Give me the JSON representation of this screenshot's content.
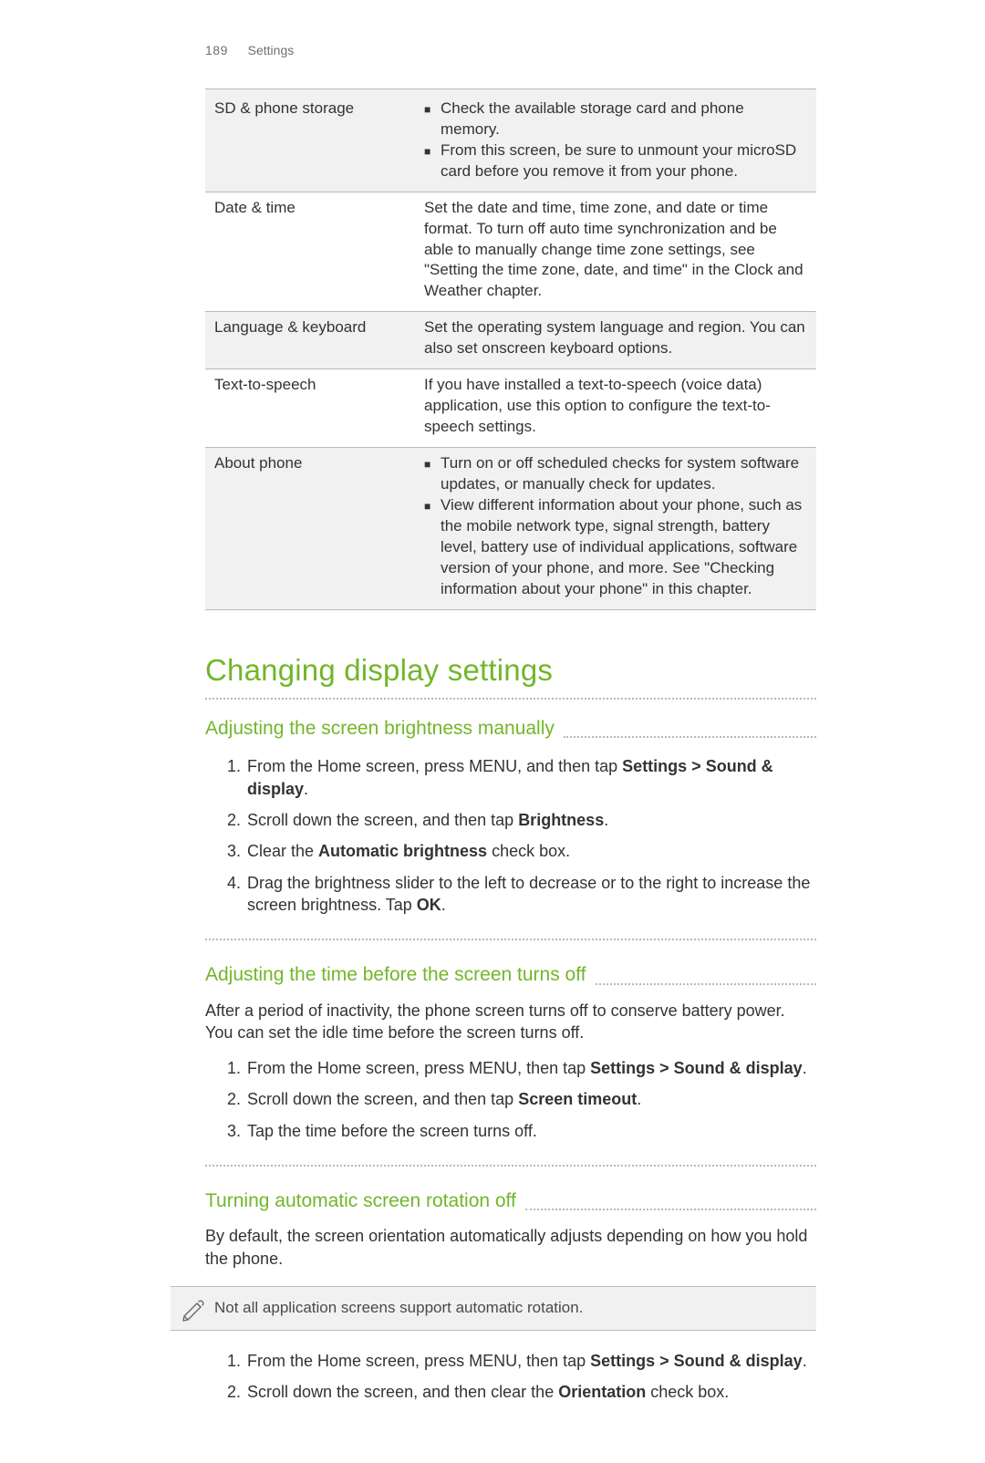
{
  "header": {
    "page_number": "189",
    "chapter": "Settings"
  },
  "settings_table": {
    "rows": [
      {
        "label": "SD & phone storage",
        "bullets": [
          "Check the available storage card and phone memory.",
          "From this screen, be sure to unmount your microSD card before you remove it from your phone."
        ]
      },
      {
        "label": "Date & time",
        "text": "Set the date and time, time zone, and date or time format. To turn off auto time synchronization and be able to manually change time zone settings, see \"Setting the time zone, date, and time\" in the Clock and Weather chapter."
      },
      {
        "label": "Language & keyboard",
        "text": "Set the operating system language and region. You can also set onscreen keyboard options."
      },
      {
        "label": "Text-to-speech",
        "text": "If you have installed a text-to-speech (voice data) application, use this option to configure the text-to-speech settings."
      },
      {
        "label": "About phone",
        "bullets": [
          "Turn on or off scheduled checks for system software updates, or manually check for updates.",
          "View different information about your phone, such as the mobile network type, signal strength, battery level, battery use of individual applications, software version of your phone, and more. See \"Checking information about your phone\" in this chapter."
        ]
      }
    ]
  },
  "section": {
    "title": "Changing display settings",
    "sub1": {
      "heading": "Adjusting the screen brightness manually",
      "steps": {
        "s1a": "From the Home screen, press MENU, and then tap ",
        "s1b": "Settings > Sound & display",
        "s1c": ".",
        "s2a": "Scroll down the screen, and then tap ",
        "s2b": "Brightness",
        "s2c": ".",
        "s3a": "Clear the ",
        "s3b": "Automatic brightness",
        "s3c": " check box.",
        "s4a": "Drag the brightness slider to the left to decrease or to the right to increase the screen brightness. Tap ",
        "s4b": "OK",
        "s4c": "."
      }
    },
    "sub2": {
      "heading": "Adjusting the time before the screen turns off",
      "intro": "After a period of inactivity, the phone screen turns off to conserve battery power. You can set the idle time before the screen turns off.",
      "steps": {
        "s1a": "From the Home screen, press MENU, then tap ",
        "s1b": "Settings > Sound & display",
        "s1c": ".",
        "s2a": "Scroll down the screen, and then tap ",
        "s2b": "Screen timeout",
        "s2c": ".",
        "s3": "Tap the time before the screen turns off."
      }
    },
    "sub3": {
      "heading": "Turning automatic screen rotation off",
      "intro": "By default, the screen orientation automatically adjusts depending on how you hold the phone.",
      "note": "Not all application screens support automatic rotation.",
      "steps": {
        "s1a": "From the Home screen, press MENU, then tap ",
        "s1b": "Settings > Sound & display",
        "s1c": ".",
        "s2a": "Scroll down the screen, and then clear the ",
        "s2b": "Orientation",
        "s2c": " check box."
      }
    }
  }
}
